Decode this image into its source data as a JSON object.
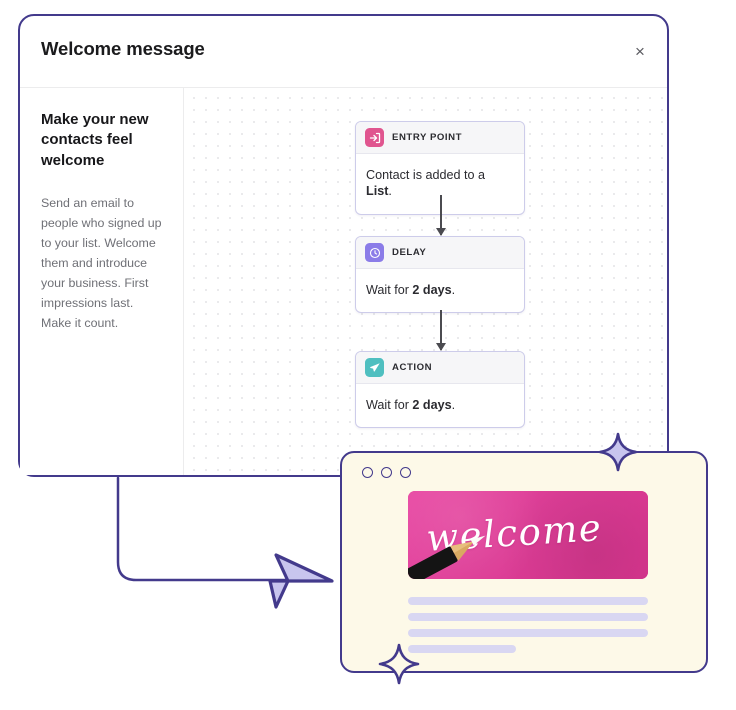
{
  "modal": {
    "title": "Welcome message",
    "close_label": "×",
    "close_icon": "close-icon"
  },
  "sidebar": {
    "heading": "Make your new contacts feel welcome",
    "body": "Send an email to people who signed up to your list. Welcome them and introduce your business. First impressions last. Make it count."
  },
  "flow": {
    "nodes": [
      {
        "type": "entry-point",
        "label": "ENTRY POINT",
        "icon": "enter-arrow-icon",
        "icon_color": "#e0558f",
        "body_prefix": "Contact is added to a ",
        "body_strong": "List",
        "body_suffix": "."
      },
      {
        "type": "delay",
        "label": "DELAY",
        "icon": "clock-icon",
        "icon_color": "#8b7ce8",
        "body_prefix": "Wait for ",
        "body_strong": "2 days",
        "body_suffix": "."
      },
      {
        "type": "action",
        "label": "ACTION",
        "icon": "paper-plane-icon",
        "icon_color": "#4fbfc0",
        "body_prefix": "Wait for ",
        "body_strong": "2 days",
        "body_suffix": "."
      }
    ]
  },
  "email_preview": {
    "window_dots": 3,
    "hero_word": "welcome",
    "hero_color": "#e0409a",
    "card_background": "#fdf9e8",
    "pencil_icon": "pencil-icon",
    "placeholder_bars": [
      100,
      100,
      100,
      45
    ]
  },
  "decorations": {
    "arrow_icon": "dart-arrow-icon",
    "sparkle_top_icon": "sparkle-icon",
    "sparkle_bottom_icon": "sparkle-icon",
    "accent_color": "#433a8c",
    "lavender_color": "#c5c2ec"
  }
}
